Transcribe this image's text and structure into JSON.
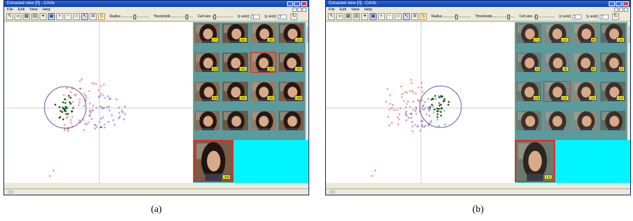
{
  "panels": [
    {
      "id": "a",
      "title": "Extracted view [0] - CAVis",
      "menu": [
        "File",
        "Edit",
        "View",
        "Help"
      ],
      "toolbar": {
        "radius_label": "Radius",
        "threshold_label": "Thresholds",
        "cellsize_label": "Cell size",
        "xaxis_label": "[x axis]:",
        "xaxis_value": "1",
        "yaxis_label": "[y axis]:",
        "yaxis_value": "2"
      },
      "thumbs": [
        "171",
        "283",
        "284",
        "301",
        "303",
        "304",
        "305",
        "307",
        "308",
        "295",
        "296",
        "299",
        "",
        "",
        "",
        ""
      ],
      "selected_index": 6,
      "detail_label": "305",
      "bg": "#7a5c46",
      "caption": "(a)"
    },
    {
      "id": "b",
      "title": "Extracted view [0] - CAVis",
      "menu": [
        "File",
        "Edit",
        "View",
        "Help"
      ],
      "toolbar": {
        "radius_label": "Radius",
        "threshold_label": "Thresholds",
        "cellsize_label": "Cell size",
        "xaxis_label": "[x axis]:",
        "xaxis_value": "1",
        "yaxis_label": "[y axis]:",
        "yaxis_value": "2"
      },
      "thumbs": [
        "171",
        "122",
        "99",
        "140",
        "91",
        "85",
        "59",
        "94",
        "126",
        "141",
        "146",
        "210",
        "",
        "",
        "",
        ""
      ],
      "selected_index": 9,
      "detail_label": "141",
      "bg": "#6b7a6e",
      "caption": "(b)"
    }
  ],
  "colors": {
    "green_cluster": "#0d5c0d",
    "red_points": "#d22a2a",
    "blue_points": "#3a34c4",
    "selection_circle": "#1a1a8c",
    "gallery_bg": "#5a9b9d",
    "detail_bg": "#00f5ff",
    "badge": "#ffff00",
    "selected_border": "#e02a2a"
  }
}
